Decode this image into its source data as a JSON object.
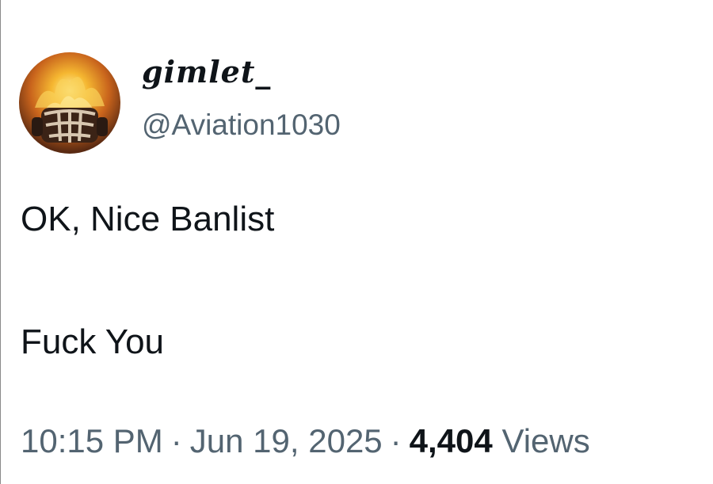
{
  "user": {
    "display_name": "gimlet_",
    "handle": "@Aviation1030",
    "avatar_icon": "flaming-helmet-icon"
  },
  "tweet": {
    "lines": [
      "OK, Nice Banlist",
      "Fuck You"
    ],
    "time": "10:15 PM",
    "separator": "·",
    "date": "Jun 19, 2025",
    "views_count": "4,404",
    "views_label": "Views"
  },
  "colors": {
    "text_primary": "#0f1419",
    "text_secondary": "#536471",
    "background": "#ffffff"
  }
}
